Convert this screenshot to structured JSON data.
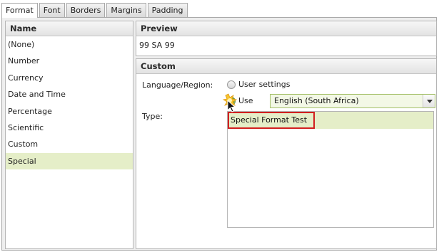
{
  "tabs": [
    "Format",
    "Font",
    "Borders",
    "Margins",
    "Padding"
  ],
  "active_tab": "Format",
  "name_panel": {
    "header": "Name",
    "items": [
      "(None)",
      "Number",
      "Currency",
      "Date and Time",
      "Percentage",
      "Scientific",
      "Custom",
      "Special"
    ],
    "selected": "Special"
  },
  "preview": {
    "header": "Preview",
    "value": "99 SA 99"
  },
  "custom": {
    "header": "Custom",
    "language_label": "Language/Region:",
    "option_user_settings": "User settings",
    "option_use": "Use",
    "selected_option": "Use",
    "language_value": "English (South Africa)",
    "type_label": "Type:",
    "type_items": [
      "Special Format Test"
    ]
  },
  "colors": {
    "selection": "#e5eec8",
    "highlight_outline": "#d21f1f",
    "accent_green": "#5e9a20"
  }
}
